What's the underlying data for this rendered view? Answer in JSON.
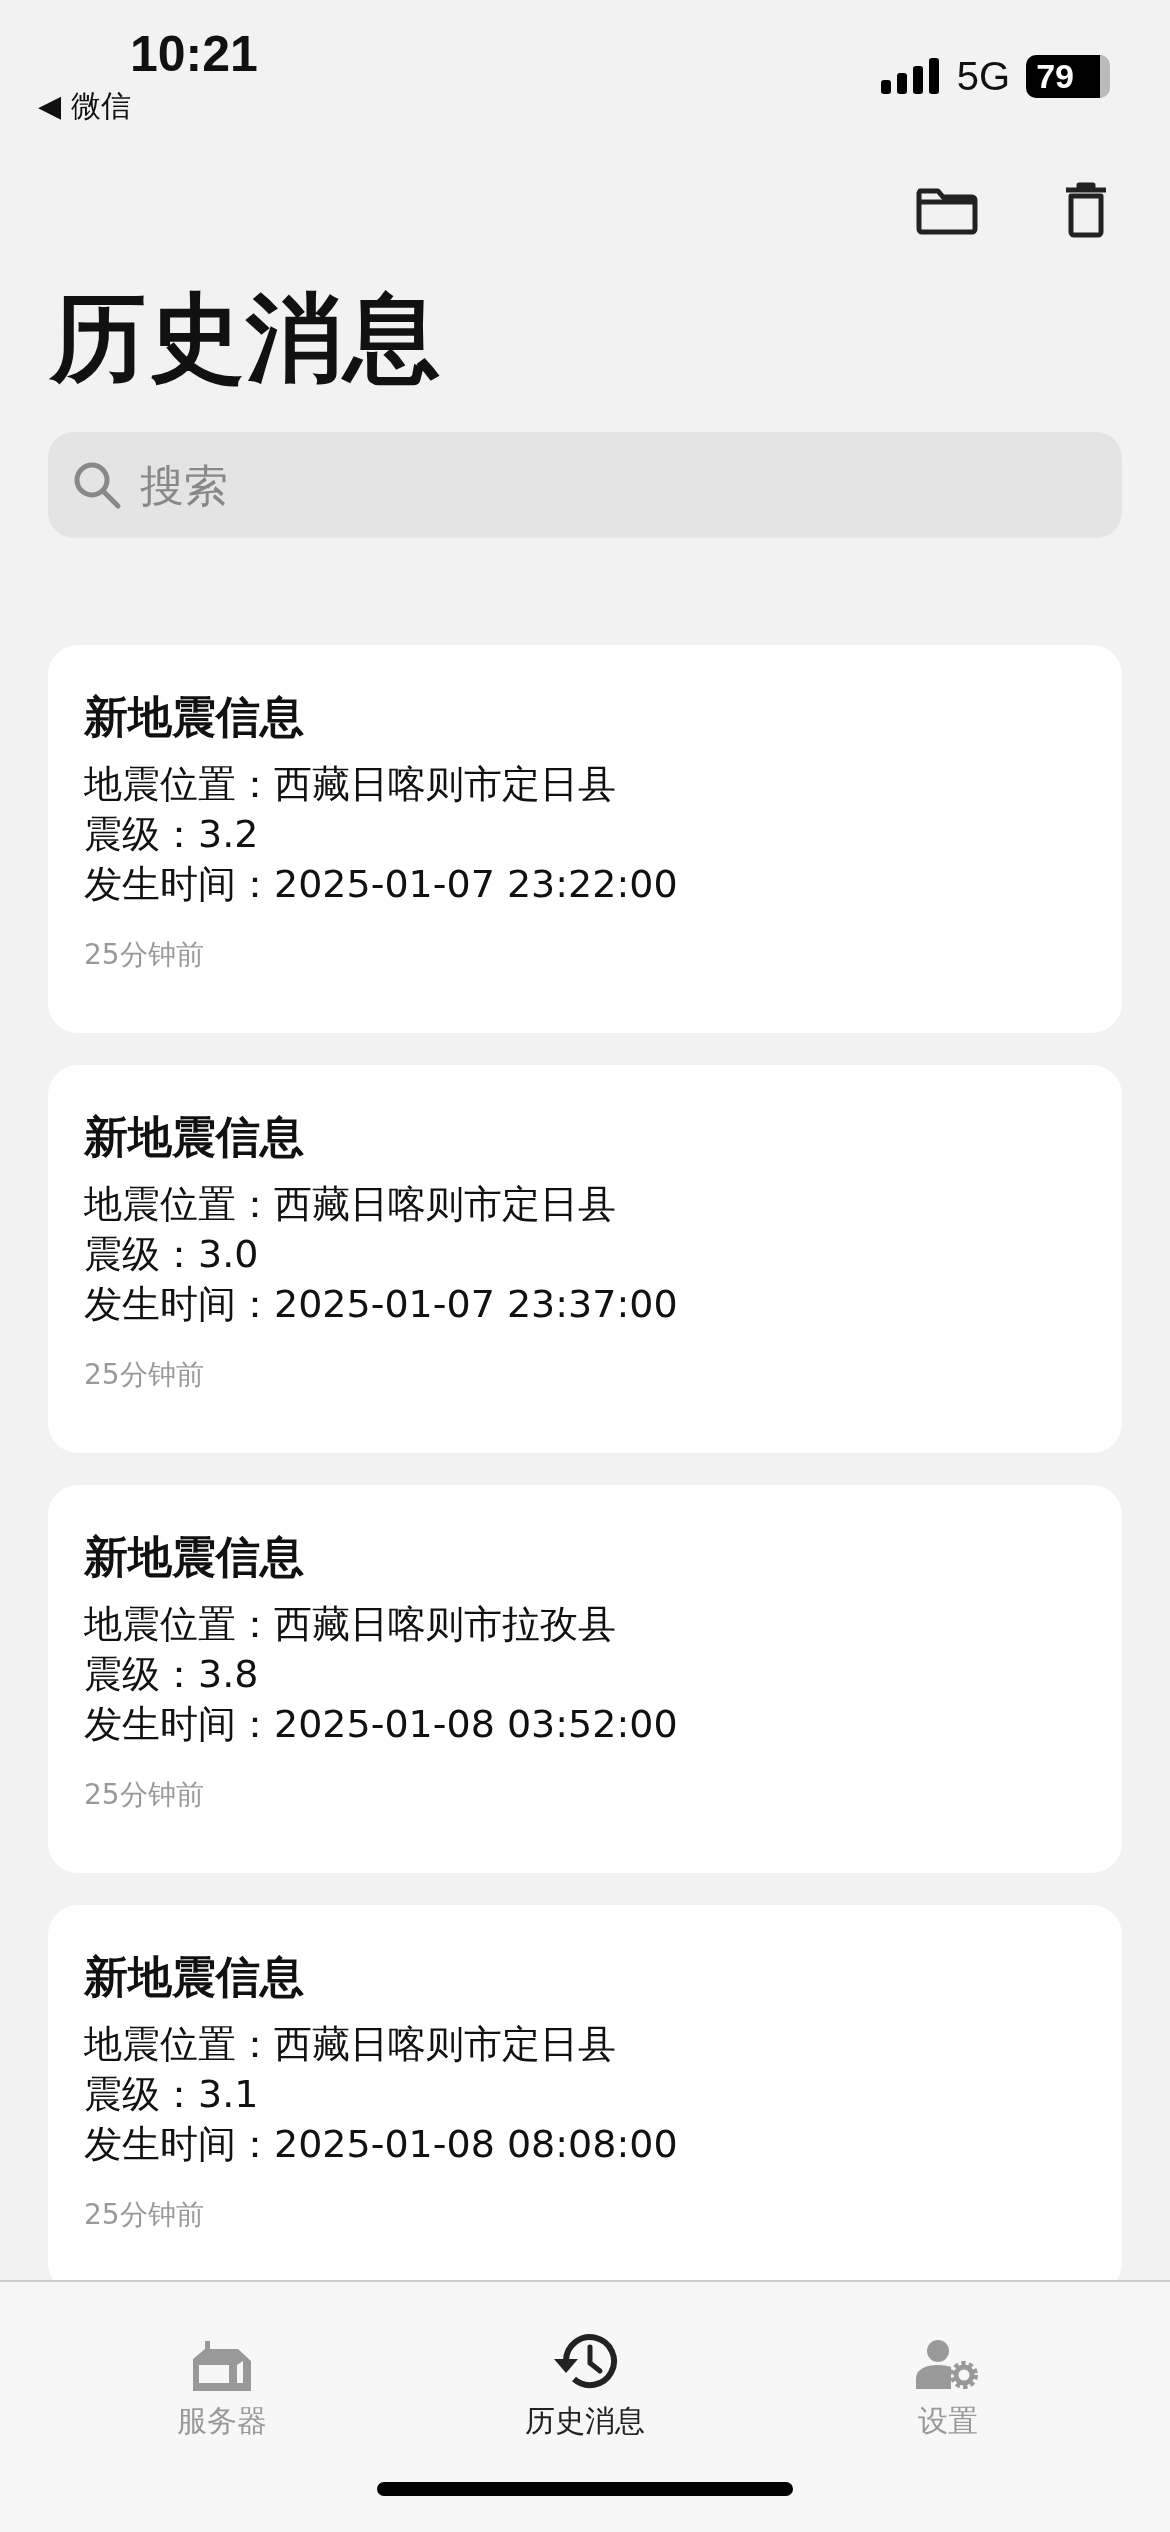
{
  "status_bar": {
    "time": "10:21",
    "back_label": "◀ 微信",
    "network": "5G",
    "battery": "79"
  },
  "title": "历史消息",
  "search": {
    "placeholder": "搜索"
  },
  "messages": [
    {
      "title": "新地震信息",
      "lines": [
        "地震位置：西藏日喀则市定日县",
        "震级：3.2",
        "发生时间：2025-01-07 23:22:00"
      ],
      "age": "25分钟前"
    },
    {
      "title": "新地震信息",
      "lines": [
        "地震位置：西藏日喀则市定日县",
        "震级：3.0",
        "发生时间：2025-01-07 23:37:00"
      ],
      "age": "25分钟前"
    },
    {
      "title": "新地震信息",
      "lines": [
        "地震位置：西藏日喀则市拉孜县",
        "震级：3.8",
        "发生时间：2025-01-08 03:52:00"
      ],
      "age": "25分钟前"
    },
    {
      "title": "新地震信息",
      "lines": [
        "地震位置：西藏日喀则市定日县",
        "震级：3.1",
        "发生时间：2025-01-08 08:08:00"
      ],
      "age": "25分钟前"
    }
  ],
  "tabs": [
    {
      "label": "服务器",
      "kind": "server",
      "selected": false
    },
    {
      "label": "历史消息",
      "kind": "history",
      "selected": true
    },
    {
      "label": "设置",
      "kind": "settings",
      "selected": false
    }
  ]
}
